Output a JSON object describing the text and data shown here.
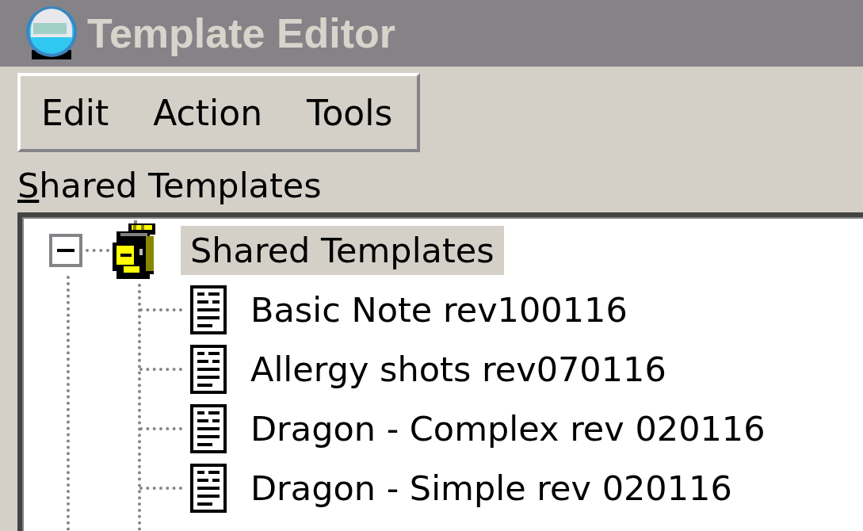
{
  "window": {
    "title": "Template Editor"
  },
  "menu": [
    "Edit",
    "Action",
    "Tools"
  ],
  "tree_label": {
    "text": "Shared Templates",
    "first_letter_underlined": true
  },
  "tree": [
    {
      "label": "Shared Templates",
      "selected": true,
      "expanded": true,
      "children": [
        {
          "label": "Basic Note rev100116",
          "selected": false
        },
        {
          "label": "Allergy shots rev070116",
          "selected": false
        },
        {
          "label": "Dragon - Complex rev 020116",
          "selected": false
        },
        {
          "label": "Dragon - Simple rev 020116",
          "selected": false
        }
      ]
    }
  ]
}
